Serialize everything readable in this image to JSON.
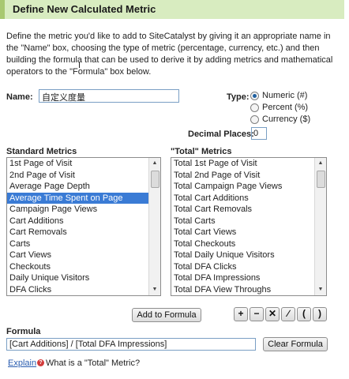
{
  "title": "Define New Calculated Metric",
  "description": {
    "p1": "Define the metric you'd like to add to SiteCatalyst by giving it an appropriate name in the \"Name\" box, choosing the type of metric (percentage, currency, etc.) and then building the formula that can be used to derive it by adding metrics and mathematical operators to the \"Formula\" box below."
  },
  "name": {
    "label": "Name:",
    "value": "自定义度量"
  },
  "type": {
    "label": "Type:",
    "options": [
      "Numeric (#)",
      "Percent (%)",
      "Currency ($)"
    ],
    "selected": "Numeric (#)"
  },
  "decimal": {
    "label": "Decimal Places:",
    "value": "0"
  },
  "standard_metrics": {
    "title": "Standard Metrics",
    "items": [
      "1st Page of Visit",
      "2nd Page of Visit",
      "Average Page Depth",
      "Average Time Spent on Page",
      "Campaign Page Views",
      "Cart Additions",
      "Cart Removals",
      "Carts",
      "Cart Views",
      "Checkouts",
      "Daily Unique Visitors",
      "DFA Clicks"
    ],
    "selected": "Average Time Spent on Page"
  },
  "total_metrics": {
    "title": "\"Total\" Metrics",
    "items": [
      "Total 1st Page of Visit",
      "Total 2nd Page of Visit",
      "Total Campaign Page Views",
      "Total Cart Additions",
      "Total Cart Removals",
      "Total Carts",
      "Total Cart Views",
      "Total Checkouts",
      "Total Daily Unique Visitors",
      "Total DFA Clicks",
      "Total DFA Impressions",
      "Total DFA View Throughs"
    ]
  },
  "buttons": {
    "add_to_formula": "Add to Formula",
    "operators": [
      "+",
      "−",
      "✕",
      "∕",
      "(",
      ")"
    ],
    "clear_formula": "Clear Formula"
  },
  "formula": {
    "label": "Formula",
    "value": "[Cart Additions] / [Total DFA Impressions]"
  },
  "footer": {
    "explain": "Explain",
    "help_text": "What is a \"Total\" Metric?"
  },
  "colors": {
    "title_bg": "#d8ecc0",
    "title_accent": "#a8c870",
    "selection": "#3a7bd5",
    "link": "#2a5db0"
  }
}
